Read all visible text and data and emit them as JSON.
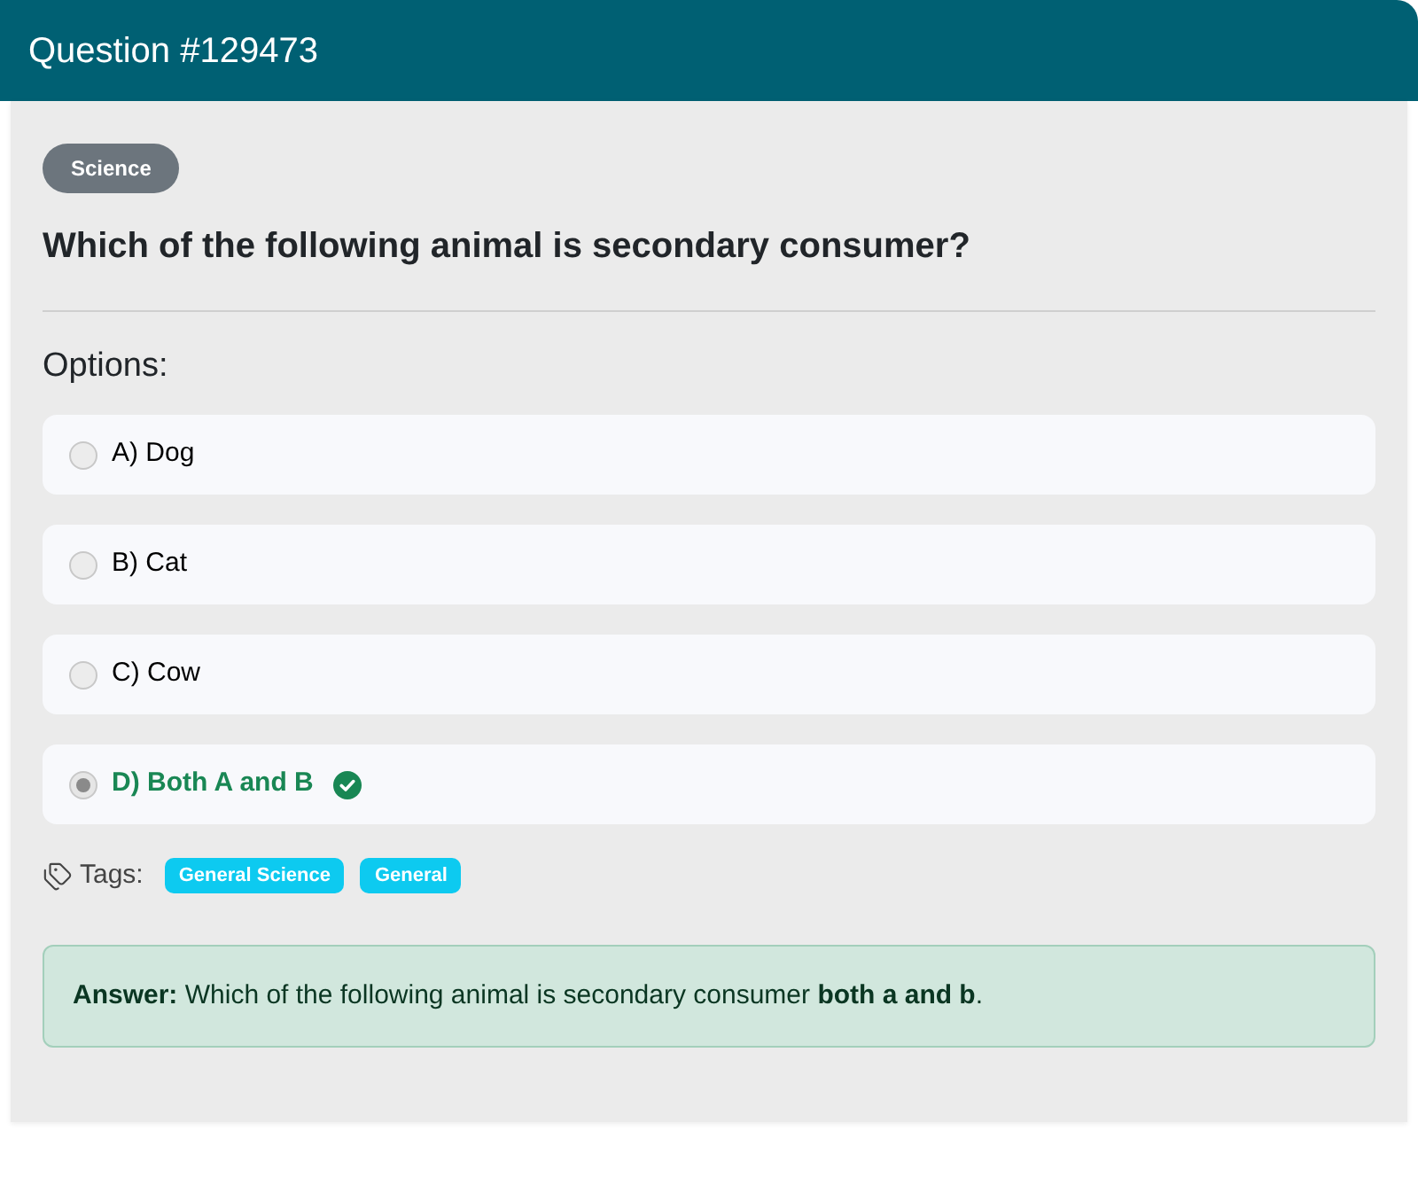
{
  "header": {
    "title": "Question #129473"
  },
  "question": {
    "category": "Science",
    "text": "Which of the following animal is secondary consumer?"
  },
  "options_label": "Options:",
  "options": [
    {
      "label": "A) Dog",
      "selected": false,
      "correct": false
    },
    {
      "label": "B) Cat",
      "selected": false,
      "correct": false
    },
    {
      "label": "C) Cow",
      "selected": false,
      "correct": false
    },
    {
      "label": "D) Both A and B",
      "selected": true,
      "correct": true
    }
  ],
  "tags": {
    "label": "Tags:",
    "items": [
      "General Science",
      "General"
    ]
  },
  "answer": {
    "text": "**Answer:** Which of the following animal is secondary consumer **both a and b**."
  }
}
